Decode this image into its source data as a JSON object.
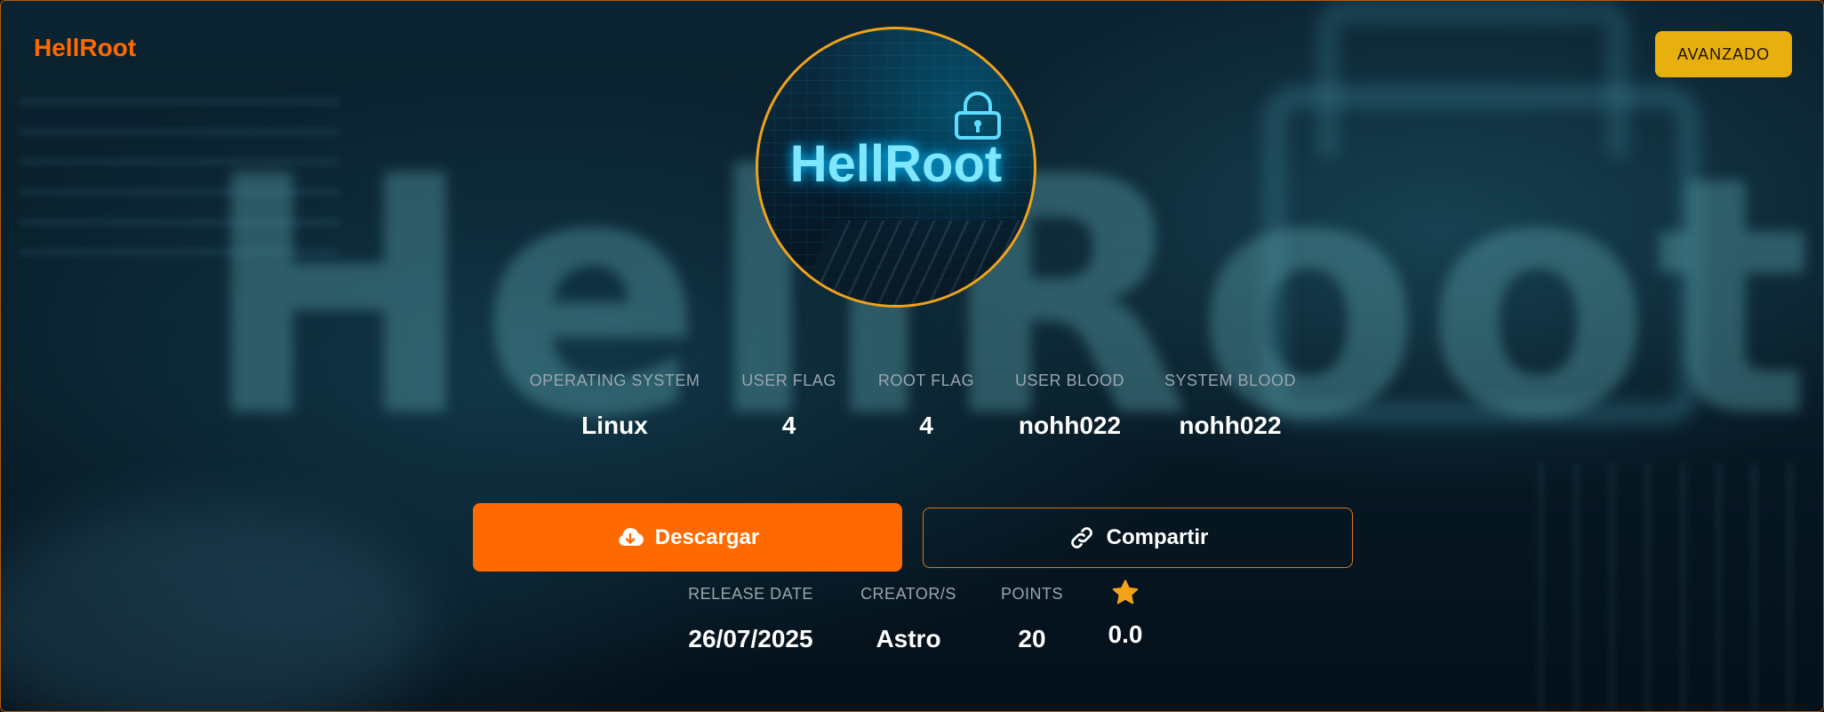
{
  "brand": "HellRoot",
  "difficulty_badge": "AVANZADO",
  "avatar": {
    "title": "HellRoot"
  },
  "background_text": "HellRoot",
  "stats": {
    "os": {
      "label": "OPERATING SYSTEM",
      "value": "Linux"
    },
    "user_flag": {
      "label": "USER FLAG",
      "value": "4"
    },
    "root_flag": {
      "label": "ROOT FLAG",
      "value": "4"
    },
    "user_blood": {
      "label": "USER BLOOD",
      "value": "nohh022"
    },
    "system_blood": {
      "label": "SYSTEM BLOOD",
      "value": "nohh022"
    }
  },
  "actions": {
    "download": {
      "label": "Descargar",
      "icon": "cloud-download-icon"
    },
    "share": {
      "label": "Compartir",
      "icon": "link-icon"
    }
  },
  "meta": {
    "release_date": {
      "label": "RELEASE DATE",
      "value": "26/07/2025"
    },
    "creators": {
      "label": "CREATOR/S",
      "value": "Astro"
    },
    "points": {
      "label": "POINTS",
      "value": "20"
    },
    "rating": {
      "icon": "star-icon",
      "value": "0.0"
    }
  },
  "colors": {
    "accent": "#ff6a00",
    "badge": "#e8b00f",
    "star": "#f5a21b",
    "avatar_border": "#f0a21a"
  }
}
